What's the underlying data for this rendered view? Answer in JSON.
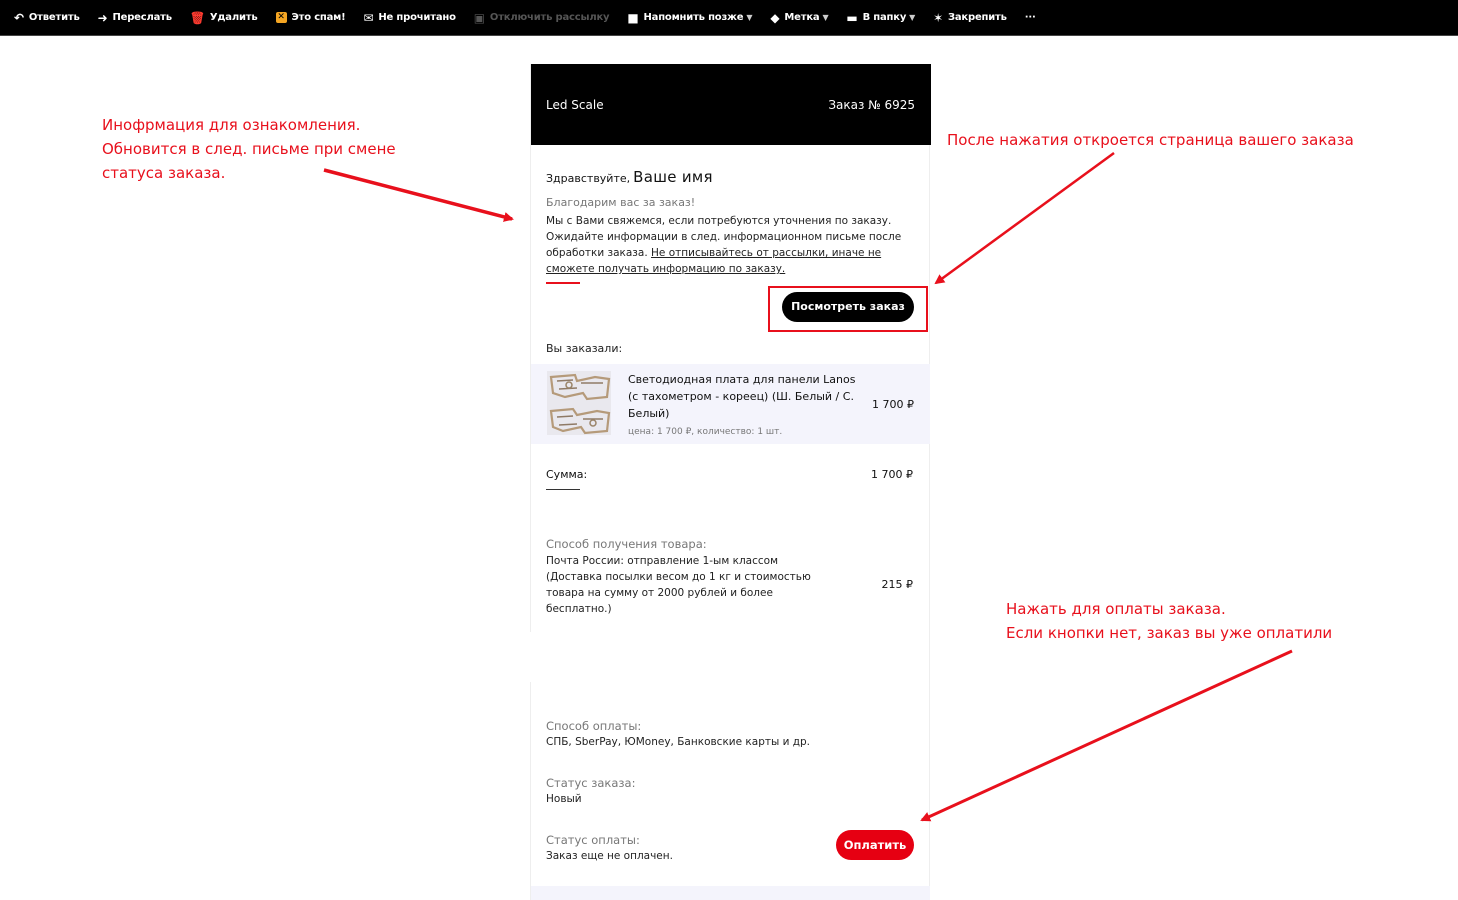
{
  "toolbar": {
    "items": [
      {
        "label": "Ответить",
        "icon": "reply-icon"
      },
      {
        "label": "Переслать",
        "icon": "forward-icon"
      },
      {
        "label": "Удалить",
        "icon": "trash-icon"
      },
      {
        "label": "Это спам!",
        "icon": "spam-icon"
      },
      {
        "label": "Не прочитано",
        "icon": "envelope-icon"
      },
      {
        "label": "Отключить рассылку",
        "icon": "unsubscribe-icon",
        "disabled": true
      },
      {
        "label": "Напомнить позже",
        "icon": "remind-icon"
      },
      {
        "label": "Метка",
        "icon": "tag-icon"
      },
      {
        "label": "В папку",
        "icon": "folder-icon"
      },
      {
        "label": "Закрепить",
        "icon": "pin-icon"
      },
      {
        "label": "···",
        "icon": "more-icon"
      }
    ]
  },
  "email": {
    "brand": "Led Scale",
    "order_number": "Заказ № 6925",
    "greeting": "Здравствуйте,",
    "name": "Ваше имя",
    "thanks": "Благодарим вас за заказ!",
    "info_plain": "Мы с Вами свяжемся, если потребуются уточнения по заказу. Ожидайте информации в след. информационном письме после обработки заказа. ",
    "info_underlined": "Не отписывайтесь от рассылки, иначе не сможете получать информацию по заказу.",
    "view_order_button": "Посмотреть заказ",
    "you_ordered": "Вы заказали:",
    "item": {
      "title": "Светодиодная плата для панели Lanos (с тахометром - кореец) (Ш. Белый / С. Белый)",
      "details": "цена: 1 700 ₽, количество: 1 шт.",
      "price": "1 700 ₽"
    },
    "sum_label": "Сумма:",
    "sum_value": "1 700 ₽",
    "delivery_title": "Способ получения товара:",
    "delivery_text": "Почта России: отправление 1-ым классом (Доставка посылки весом до 1 кг и стоимостью товара на сумму от 2000 рублей и более бесплатно.)",
    "delivery_price": "215 ₽",
    "payment_title": "Способ оплаты:",
    "payment_text": "СПБ, SberPay, ЮMoney, Банковские карты и др.",
    "order_status_title": "Статус заказа:",
    "order_status": "Новый",
    "payment_status_title": "Статус оплаты:",
    "payment_status": "Заказ еще не оплачен.",
    "pay_button": "Оплатить"
  },
  "annotations": {
    "info_note": [
      "Инофрмация для ознакомления.",
      "Обновится в след. письме при смене",
      "статуса заказа."
    ],
    "view_note": "После нажатия откроется страница вашего заказа",
    "pay_note": [
      "Нажать для оплаты заказа.",
      "Если кнопки нет, заказ вы уже оплатили"
    ]
  },
  "colors": {
    "annotation_red": "#e8101c",
    "pay_button": "#e60012",
    "header_bg": "#000000",
    "item_row_bg": "#f4f4fc"
  }
}
